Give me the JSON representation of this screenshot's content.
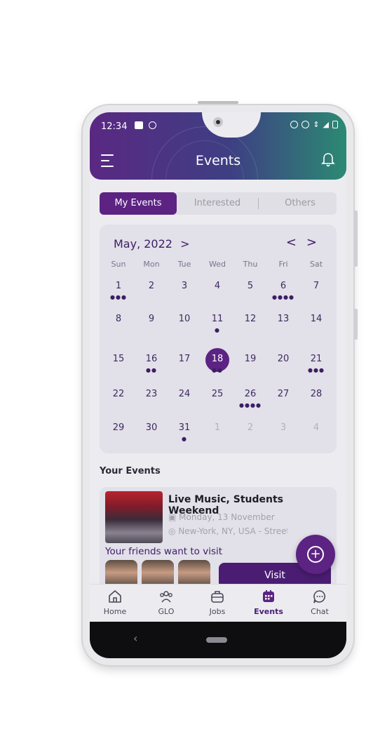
{
  "status_bar": {
    "time": "12:34"
  },
  "header": {
    "title": "Events"
  },
  "tabs": [
    {
      "label": "My Events",
      "active": true
    },
    {
      "label": "Interested",
      "active": false
    },
    {
      "label": "Others",
      "active": false
    }
  ],
  "calendar": {
    "month_label": "May, 2022",
    "month_chevron": ">",
    "prev": "<",
    "next": ">",
    "weekdays": [
      "Sun",
      "Mon",
      "Tue",
      "Wed",
      "Thu",
      "Fri",
      "Sat"
    ],
    "weeks": [
      [
        "1",
        "2",
        "3",
        "4",
        "5",
        "6",
        "7"
      ],
      [
        "8",
        "9",
        "10",
        "11",
        "12",
        "13",
        "14"
      ],
      [
        "15",
        "16",
        "17",
        "18",
        "19",
        "20",
        "21"
      ],
      [
        "22",
        "23",
        "24",
        "25",
        "26",
        "27",
        "28"
      ],
      [
        "29",
        "30",
        "31",
        "1",
        "2",
        "3",
        "4"
      ]
    ],
    "selected_day": "18",
    "event_dots": {
      "1": 3,
      "6": 4,
      "11": 1,
      "16": 2,
      "18": 2,
      "21": 3,
      "26": 4,
      "31": 1
    }
  },
  "your_events": {
    "title": "Your Events",
    "event": {
      "name": "Live Music, Students Weekend",
      "date": "Monday, 13 November",
      "location": "New-York, NY, USA - Street F"
    },
    "friends_label": "Your friends want to visit",
    "visit_label": "Visit"
  },
  "bottom_nav": [
    {
      "label": "Home",
      "icon": "home-icon",
      "active": false
    },
    {
      "label": "GLO",
      "icon": "group-icon",
      "active": false
    },
    {
      "label": "Jobs",
      "icon": "briefcase-icon",
      "active": false
    },
    {
      "label": "Events",
      "icon": "calendar-icon",
      "active": true
    },
    {
      "label": "Chat",
      "icon": "chat-icon",
      "active": false
    }
  ],
  "colors": {
    "brand": "#5c2383",
    "header_start": "#5a2883",
    "header_end": "#2b8a73"
  }
}
